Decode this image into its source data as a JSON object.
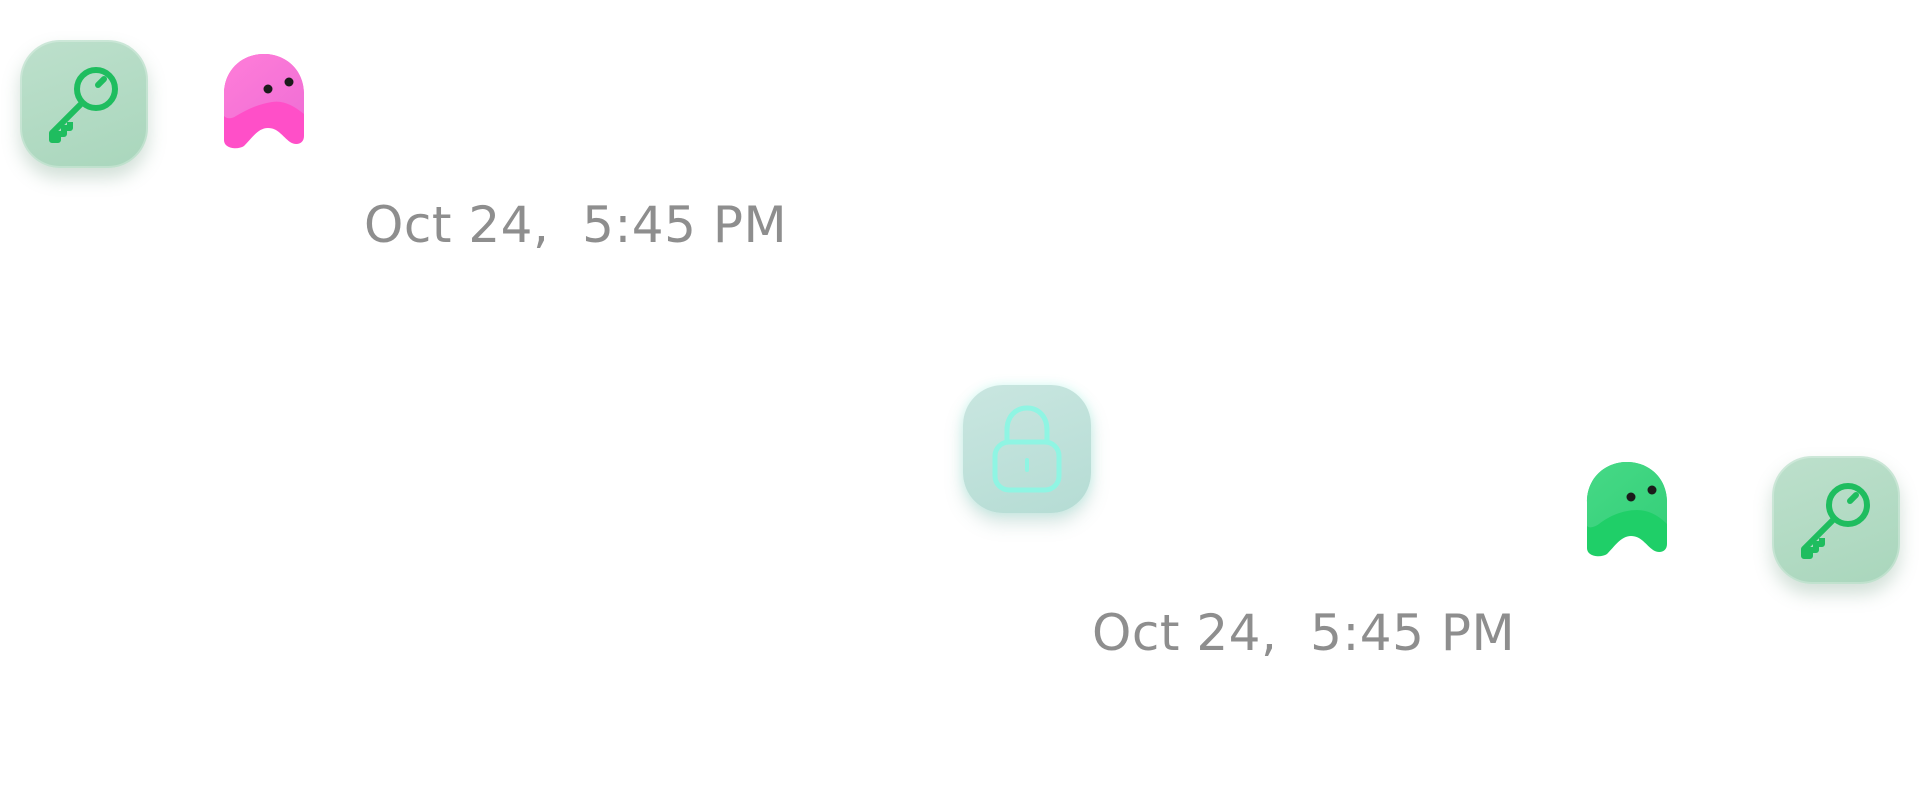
{
  "colors": {
    "key_tile": "#b3dbc4",
    "key_stroke": "#1fbd5f",
    "lock_tile": "#bfe1da",
    "lock_stroke": "#8ff5e3",
    "ghost_pink": "#ff4fc8",
    "ghost_green": "#1fcf68",
    "timestamp": "#8e8e8e"
  },
  "messages": [
    {
      "side": "incoming",
      "avatar_icon": "pink-ghost-avatar",
      "status_icon": "key-icon",
      "timestamp": "Oct 24,  5:45 PM"
    },
    {
      "side": "outgoing",
      "avatar_icon": "green-ghost-avatar",
      "status_icon": "key-icon",
      "timestamp": "Oct 24,  5:45 PM"
    }
  ],
  "center_status": {
    "icon": "lock-icon"
  }
}
